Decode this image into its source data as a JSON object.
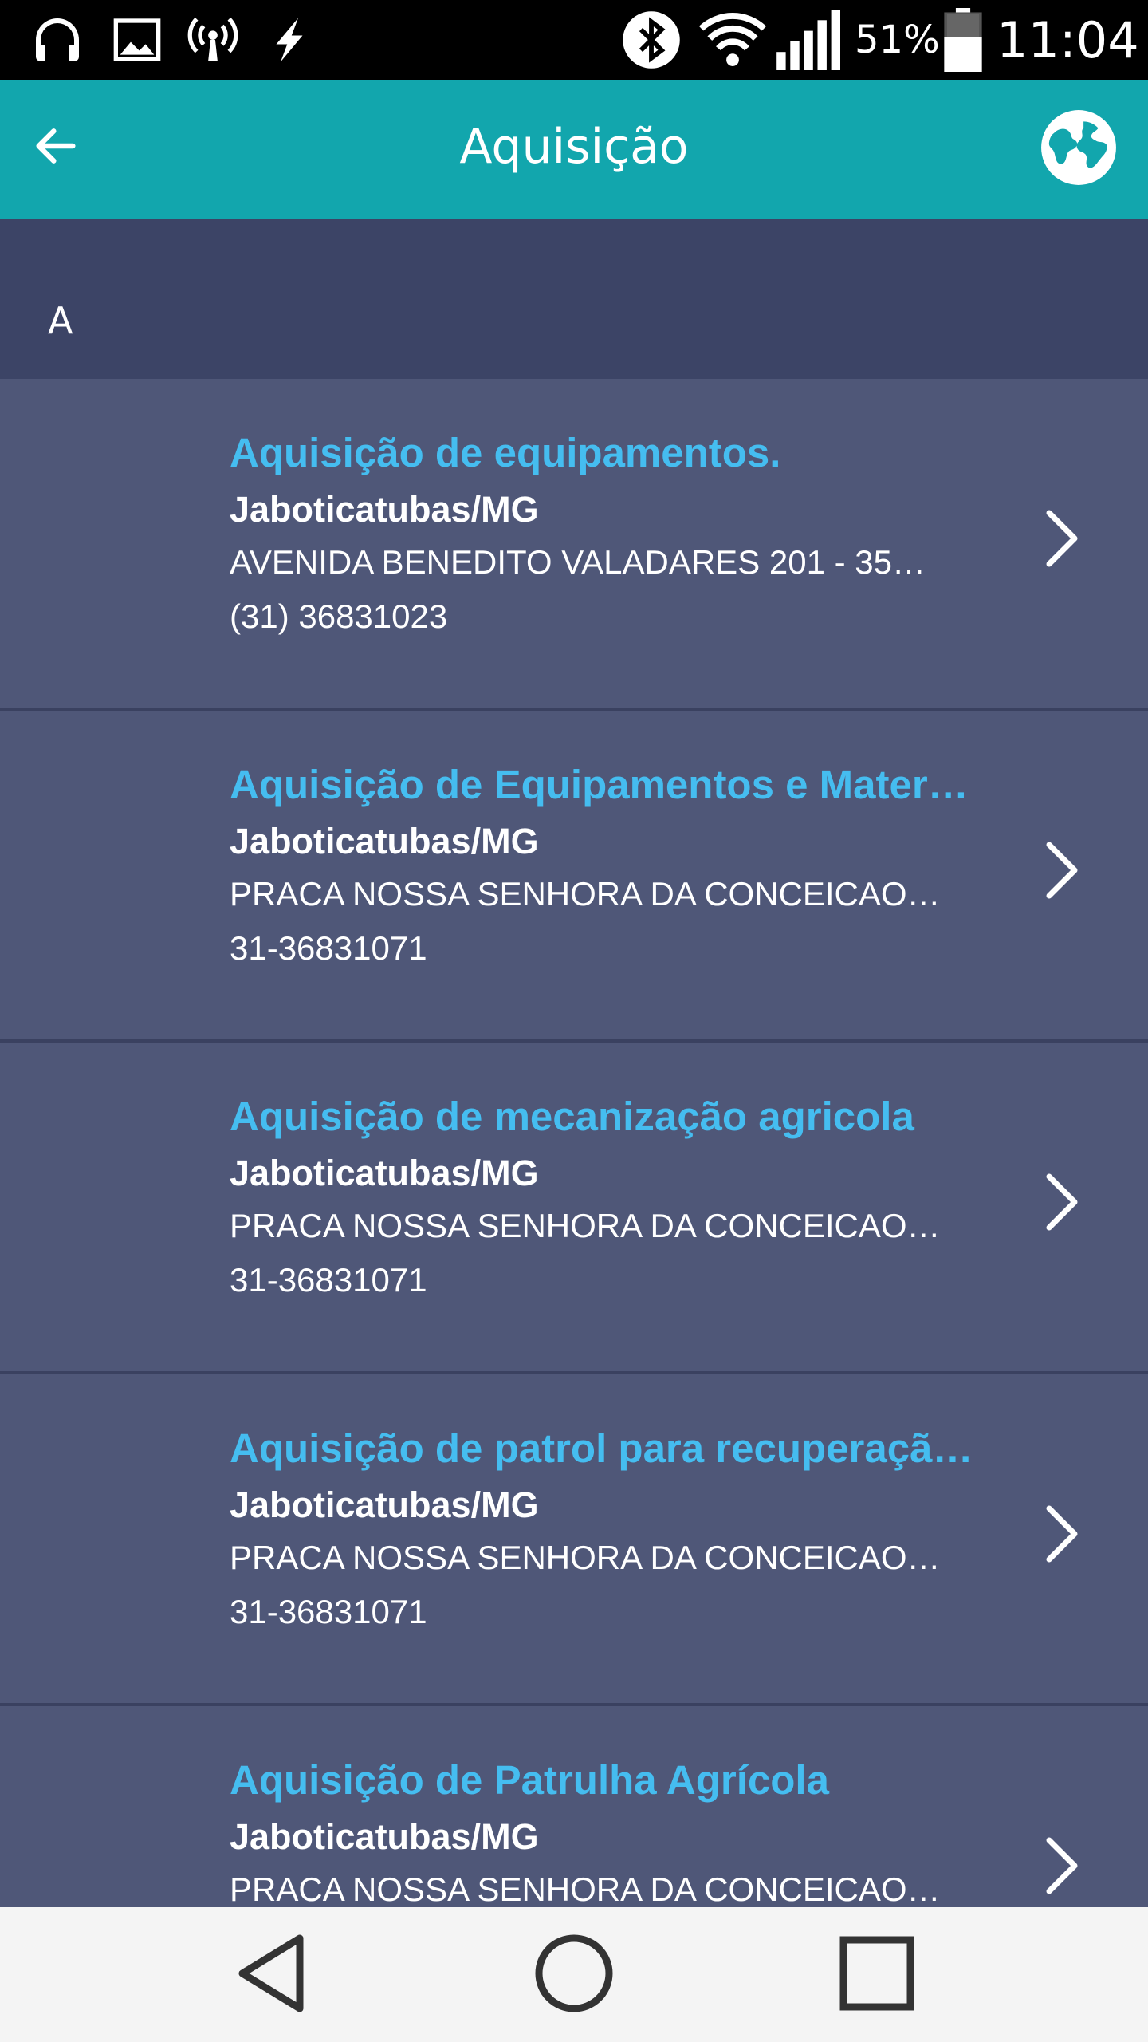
{
  "status_bar": {
    "battery": "51%",
    "time": "11:04"
  },
  "app_bar": {
    "title": "Aquisição"
  },
  "section": {
    "letter": "A"
  },
  "items": [
    {
      "title": "Aquisição de equipamentos.",
      "city": "Jaboticatubas/MG",
      "address": "AVENIDA BENEDITO VALADARES 201 - 35…",
      "phone": "(31) 36831023"
    },
    {
      "title": "Aquisição de Equipamentos e Mater…",
      "city": "Jaboticatubas/MG",
      "address": "PRACA NOSSA SENHORA DA CONCEICAO…",
      "phone": "31-36831071"
    },
    {
      "title": "Aquisição de mecanização agricola",
      "city": "Jaboticatubas/MG",
      "address": "PRACA NOSSA SENHORA DA CONCEICAO…",
      "phone": "31-36831071"
    },
    {
      "title": "Aquisição de patrol para recuperaçã…",
      "city": "Jaboticatubas/MG",
      "address": "PRACA NOSSA SENHORA DA CONCEICAO…",
      "phone": "31-36831071"
    },
    {
      "title": "Aquisição de Patrulha Agrícola",
      "city": "Jaboticatubas/MG",
      "address": "PRACA NOSSA SENHORA DA CONCEICAO…",
      "phone": ""
    }
  ],
  "colors": {
    "app_bar": "#12a6ad",
    "section_header": "#3c4466",
    "list_bg": "#4f5778",
    "title_accent": "#45bdf0"
  },
  "icons": {
    "back": "arrow-left-icon",
    "globe": "globe-icon",
    "chevron": "chevron-right-icon",
    "nav_back": "triangle-back-icon",
    "nav_home": "circle-home-icon",
    "nav_recents": "square-recents-icon"
  }
}
